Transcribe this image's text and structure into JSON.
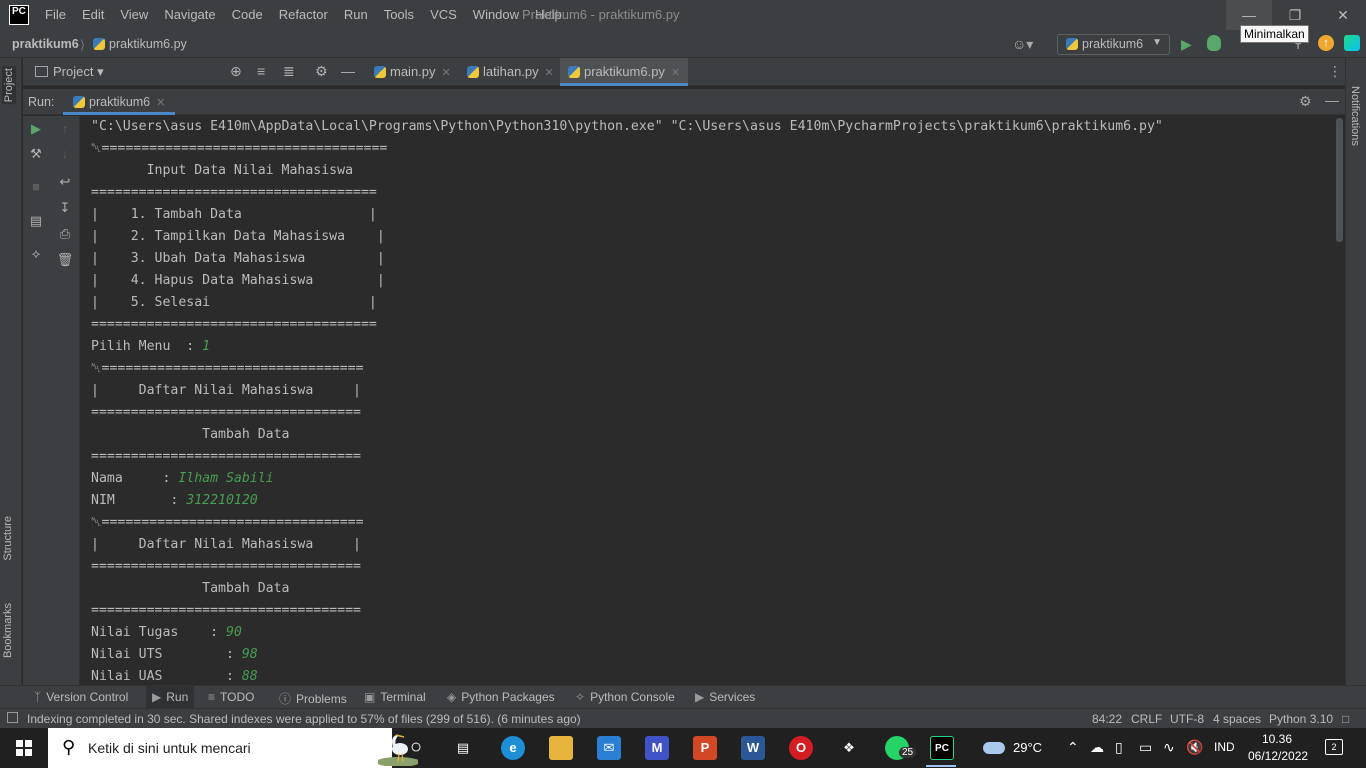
{
  "window": {
    "logo": "PC",
    "menu": [
      "File",
      "Edit",
      "View",
      "Navigate",
      "Code",
      "Refactor",
      "Run",
      "Tools",
      "VCS",
      "Window",
      "Help"
    ],
    "title": "Praktikum6 - praktikum6.py",
    "tooltip": "Minimalkan"
  },
  "navbar": {
    "project": "praktikum6",
    "file": "praktikum6.py",
    "run_config": "praktikum6"
  },
  "sidebar": {
    "project_tab": "Project",
    "structure_tab": "Structure",
    "bookmarks_tab": "Bookmarks",
    "notifications_tab": "Notifications"
  },
  "project_panel": {
    "label": "Project"
  },
  "editor_tabs": [
    {
      "label": "main.py"
    },
    {
      "label": "latihan.py"
    },
    {
      "label": "praktikum6.py"
    }
  ],
  "run_panel": {
    "label": "Run:",
    "tab": "praktikum6"
  },
  "console": {
    "lines": [
      {
        "text": "\"C:\\Users\\asus E410m\\AppData\\Local\\Programs\\Python\\Python310\\python.exe\" \"C:\\Users\\asus E410m\\PycharmProjects\\praktikum6\\praktikum6.py\"",
        "input": ""
      },
      {
        "text": "\u0000====================================",
        "input": ""
      },
      {
        "text": "       Input Data Nilai Mahasiswa",
        "input": ""
      },
      {
        "text": "====================================",
        "input": ""
      },
      {
        "text": "|    1. Tambah Data                |",
        "input": ""
      },
      {
        "text": "|    2. Tampilkan Data Mahasiswa    |",
        "input": ""
      },
      {
        "text": "|    3. Ubah Data Mahasiswa         |",
        "input": ""
      },
      {
        "text": "|    4. Hapus Data Mahasiswa        |",
        "input": ""
      },
      {
        "text": "|    5. Selesai                    |",
        "input": ""
      },
      {
        "text": "====================================",
        "input": ""
      },
      {
        "text": "Pilih Menu  : ",
        "input": "1"
      },
      {
        "text": "\u0000=================================",
        "input": ""
      },
      {
        "text": "|     Daftar Nilai Mahasiswa     |",
        "input": ""
      },
      {
        "text": "==================================",
        "input": ""
      },
      {
        "text": "              Tambah Data",
        "input": ""
      },
      {
        "text": "==================================",
        "input": ""
      },
      {
        "text": "Nama     : ",
        "input": "Ilham Sabili"
      },
      {
        "text": "NIM       : ",
        "input": "312210120"
      },
      {
        "text": "\u0000=================================",
        "input": ""
      },
      {
        "text": "|     Daftar Nilai Mahasiswa     |",
        "input": ""
      },
      {
        "text": "==================================",
        "input": ""
      },
      {
        "text": "              Tambah Data",
        "input": ""
      },
      {
        "text": "==================================",
        "input": ""
      },
      {
        "text": "Nilai Tugas    : ",
        "input": "90"
      },
      {
        "text": "Nilai UTS        : ",
        "input": "98"
      },
      {
        "text": "Nilai UAS        : ",
        "input": "88"
      }
    ]
  },
  "bottom_tabs": [
    {
      "label": "Version Control",
      "icon": "branch-icon"
    },
    {
      "label": "Run",
      "icon": "run-icon"
    },
    {
      "label": "TODO",
      "icon": "list-icon"
    },
    {
      "label": "Problems",
      "icon": "problems-icon"
    },
    {
      "label": "Terminal",
      "icon": "terminal-icon"
    },
    {
      "label": "Python Packages",
      "icon": "packages-icon"
    },
    {
      "label": "Python Console",
      "icon": "python-console-icon"
    },
    {
      "label": "Services",
      "icon": "services-icon"
    }
  ],
  "status": {
    "message": "Indexing completed in 30 sec. Shared indexes were applied to 57% of files (299 of 516). (6 minutes ago)",
    "position": "84:22",
    "line_sep": "CRLF",
    "encoding": "UTF-8",
    "indent": "4 spaces",
    "interpreter": "Python 3.10"
  },
  "taskbar": {
    "search_placeholder": "Ketik di sini untuk mencari",
    "temperature": "29°C",
    "language": "IND",
    "time": "10.36",
    "date": "06/12/2022",
    "whatsapp_badge": "25",
    "notifications_count": "2"
  }
}
